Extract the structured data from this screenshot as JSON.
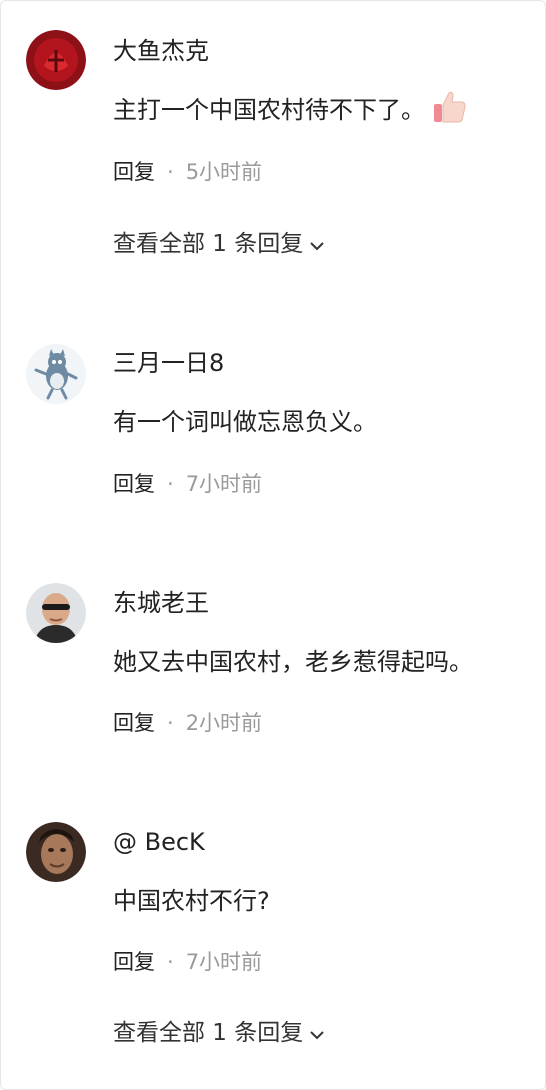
{
  "comments": [
    {
      "username": "大鱼杰克",
      "content": "主打一个中国农村待不下了。",
      "reply_label": "回复",
      "separator": "·",
      "time": "5小时前",
      "view_replies": "查看全部 1 条回复",
      "emoji": "thumbs-up-icon"
    },
    {
      "username": "三月一日8",
      "content": "有一个词叫做忘恩负义。",
      "reply_label": "回复",
      "separator": "·",
      "time": "7小时前"
    },
    {
      "username": "东城老王",
      "content": "她又去中国农村，老乡惹得起吗。",
      "reply_label": "回复",
      "separator": "·",
      "time": "2小时前"
    },
    {
      "username": "@ BecK",
      "content": "中国农村不行?",
      "reply_label": "回复",
      "separator": "·",
      "time": "7小时前",
      "view_replies": "查看全部 1 条回复"
    }
  ],
  "colors": {
    "text": "#222222",
    "muted": "#9a9a9a"
  }
}
